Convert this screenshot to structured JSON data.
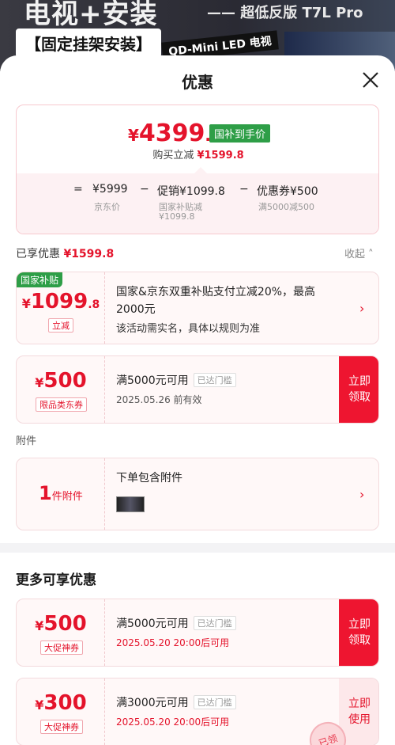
{
  "banner": {
    "title": "电视+安装",
    "subtitle": "—— 超低反版 T7L Pro",
    "badge": "【固定挂架安装】",
    "tv_label": "QD-Mini LED 电视"
  },
  "sheet": {
    "title": "优惠",
    "close_icon": "close-icon"
  },
  "price": {
    "currency": "¥",
    "integer": "4399",
    "decimal": ".2",
    "tag": "国补到手价",
    "reduce_label": "购买立减",
    "reduce_amount": "¥1599.8"
  },
  "formula": {
    "equals": "=",
    "base_price": "¥5999",
    "base_label": "京东价",
    "minus1": "−",
    "promo": "促销¥1099.8",
    "promo_sub1": "国家补贴减",
    "promo_sub2": "¥1099.8",
    "minus2": "−",
    "coupon": "优惠券¥500",
    "coupon_sub": "满5000减500"
  },
  "enjoyed": {
    "label": "已享优惠",
    "amount": "¥1599.8",
    "collapse": "收起"
  },
  "gov_subsidy": {
    "badge": "国家补贴",
    "currency": "¥",
    "amount": "1099",
    "decimal": ".8",
    "label": "立减",
    "text1": "国家&京东双重补贴支付立减20%，最高",
    "text2": "2000元",
    "text3": "该活动需实名，具体以规则为准"
  },
  "coupon1": {
    "currency": "¥",
    "amount": "500",
    "label": "限品类东券",
    "title": "满5000元可用",
    "reach": "已达门槛",
    "validity": "2025.05.26 前有效",
    "button_line1": "立即",
    "button_line2": "领取"
  },
  "attachment": {
    "section": "附件",
    "count": "1",
    "unit": "件附件",
    "text": "下单包含附件"
  },
  "more": {
    "title": "更多可享优惠"
  },
  "coupon2": {
    "currency": "¥",
    "amount": "500",
    "label": "大促神券",
    "title": "满5000元可用",
    "reach": "已达门槛",
    "validity": "2025.05.20  20:00后可用",
    "button_line1": "立即",
    "button_line2": "领取"
  },
  "coupon3": {
    "currency": "¥",
    "amount": "300",
    "label": "大促神券",
    "title": "满3000元可用",
    "reach": "已达门槛",
    "validity": "2025.05.20  20:00后可用",
    "button_line1": "立即",
    "button_line2": "使用",
    "stamp": "已领"
  },
  "colors": {
    "accent_red": "#e4132b",
    "button_red": "#ee1530",
    "subsidy_green": "#2e9e47"
  }
}
